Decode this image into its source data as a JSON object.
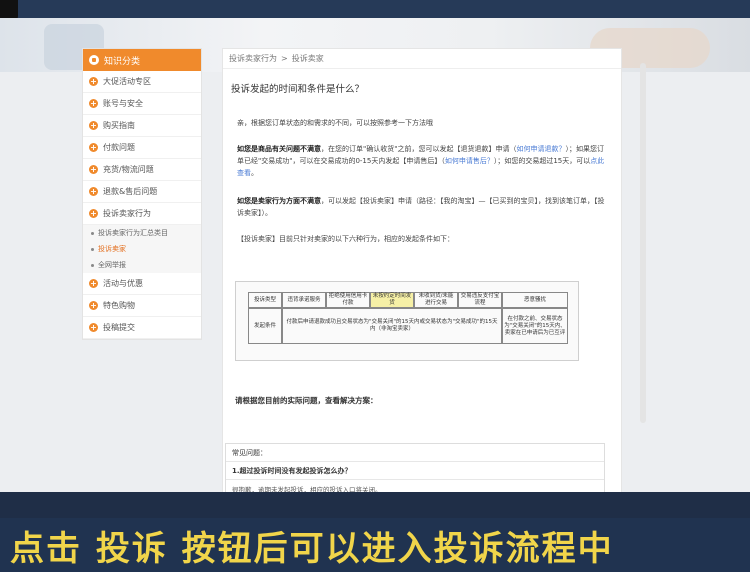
{
  "sidebar": {
    "header": "知识分类",
    "items": [
      {
        "label": "大促活动专区"
      },
      {
        "label": "账号与安全"
      },
      {
        "label": "购买指南"
      },
      {
        "label": "付款问题"
      },
      {
        "label": "充货/物流问题"
      },
      {
        "label": "退款&售后问题"
      },
      {
        "label": "投诉卖家行为"
      }
    ],
    "sub_items": [
      {
        "label": "投诉卖家行为汇总类目"
      },
      {
        "label": "投诉卖家"
      },
      {
        "label": "全网举报"
      }
    ],
    "items_after": [
      {
        "label": "活动与优惠"
      },
      {
        "label": "特色购物"
      },
      {
        "label": "投稿提交"
      }
    ]
  },
  "breadcrumb": {
    "first": "投诉卖家行为",
    "separator": ">",
    "second": "投诉卖家"
  },
  "article": {
    "title": "投诉发起的时间和条件是什么？",
    "p1": "亲，根据您订单状态的和需求的不同，可以按照参考一下方法哦",
    "p2_bold": "如您是商品有关问题不满意",
    "p2_a": "，在您的订单\"确认收货\"之前，您可以发起【退货退款】申请（",
    "p2_link1": "如何申请退款？",
    "p2_b": "）；如果您订单已经\"交易成功\"，可以在交易成功的0-15天内发起【申请售后】（",
    "p2_link2": "如何申请售后？",
    "p2_c": "）；如您的交易超过15天，可以",
    "p2_link3": "点此查看",
    "p2_d": "。",
    "p3_bold": "如您是卖家行为方面不满意",
    "p3_a": "，可以发起【投诉卖家】申请（路径：【我的淘宝】—【已买到的宝贝】，找到该笔订单，【投诉卖家】）。",
    "p4": "【投诉卖家】目前只针对卖家的以下六种行为，相应的发起条件如下：",
    "solution": "请根据您目前的实际问题，查看解决方案："
  },
  "table": {
    "headers": [
      "投诉类型",
      "违背承诺服务",
      "拒绝使用信用卡付款",
      "未按约定时间发货",
      "未收到货/未能进行交易",
      "交易违反支付宝流程",
      "恶意骚扰"
    ],
    "row_label": "发起条件",
    "row_main": "付款后申请退款成功且交易状态为\"交易关闭\"的15天内或交易状态为\"交易成功\"的15天内（非淘宝卖家）",
    "row_last": "在付款之前、交易状态为\"交易关闭\"的15天内、卖家在已申请后为已互评"
  },
  "faq": {
    "header": "常见问题：",
    "question": "1.超过投诉时间没有发起投诉怎么办？",
    "answer": "很抱歉，逾期未发起投诉，相应的投诉入口将关闭。"
  },
  "caption": "点击 投诉 按钮后可以进入投诉流程中",
  "colors": {
    "accent": "#f08a2c",
    "link": "#4a7bd4",
    "caption_text": "#f1d54a",
    "caption_bg": "#203350"
  }
}
